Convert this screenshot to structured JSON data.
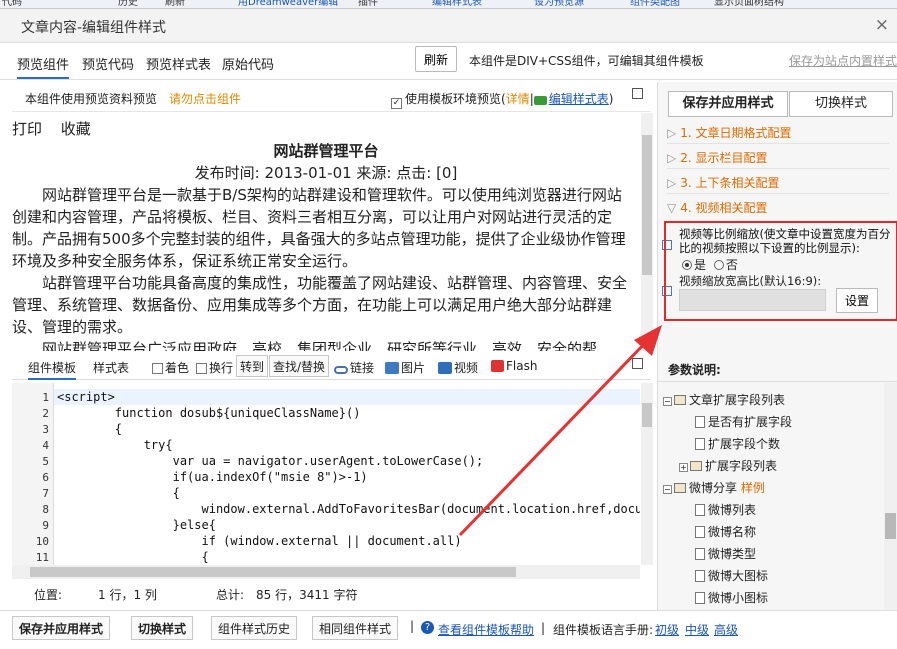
{
  "bgbar": {
    "items": [
      "代码",
      "历史",
      "刷新",
      "用Dreamweaver编辑",
      "插件",
      "编辑样式表",
      "设为预览源",
      "组件类配图",
      "显示页面树结构"
    ]
  },
  "dialog": {
    "title": "文章内容-编辑组件样式",
    "close": "×"
  },
  "tabs": [
    {
      "label": "预览组件",
      "active": true
    },
    {
      "label": "预览代码"
    },
    {
      "label": "预览样式表"
    },
    {
      "label": "原始代码"
    }
  ],
  "toolbar": {
    "refresh": "刷新",
    "note": "本组件是DIV+CSS组件，可编辑其组件模板",
    "save_site": "保存为站点内置样式"
  },
  "preview_head": {
    "label": "本组件使用预览资料预览",
    "click": "请勿点击组件",
    "checkbox": "使用模板环境预览(",
    "detail": "详情",
    "sep": "|",
    "edit_css": "编辑样式表",
    "close": ")"
  },
  "article": {
    "actions": [
      "打印",
      "收藏"
    ],
    "title": "网站群管理平台",
    "meta": "发布时间:  2013-01-01 来源:      点击: [0]",
    "paragraphs": [
      "网站群管理平台是一款基于B/S架构的站群建设和管理软件。可以使用纯浏览器进行网站创建和内容管理，产品将模板、栏目、资料三者相互分离，可以让用户对网站进行灵活的定制。产品拥有500多个完整封装的组件，具备强大的多站点管理功能，提供了企业级协作管理环境及多种安全服务体系，保证系统正常安全运行。",
      "站群管理平台功能具备高度的集成性，功能覆盖了网站建设、站群管理、内容管理、安全管理、系统管理、数据备份、应用集成等多个方面，在功能上可以满足用户绝大部分站群建设、管理的需求。",
      "网站群管理平台广泛应用政府、高校、集团型企业、研究所等行业、高效、安全的帮"
    ]
  },
  "editor_toolbar": {
    "tab_template": "组件模板",
    "tab_css": "样式表",
    "color": "着色",
    "wrap": "换行",
    "goto": "转到",
    "find": "查找/替换",
    "link": "链接",
    "image": "图片",
    "video": "视频",
    "flash": "Flash"
  },
  "code": {
    "lines": [
      "<script>",
      "        function dosub${uniqueClassName}()",
      "        {",
      "            try{",
      "                var ua = navigator.userAgent.toLowerCase();",
      "                if(ua.indexOf(\"msie 8\")>-1)",
      "                {",
      "                    window.external.AddToFavoritesBar(document.location.href,document.t",
      "                }else{",
      "                    if (window.external || document.all)",
      "                    {"
    ],
    "numbers": [
      "1",
      "2",
      "3",
      "4",
      "5",
      "6",
      "7",
      "8",
      "9",
      "10",
      "11"
    ]
  },
  "status": {
    "pos_label": "位置:",
    "pos": "1 行，1 列",
    "total_label": "总计:",
    "total": "85 行，3411 字符"
  },
  "footer": {
    "save_apply": "保存并应用样式",
    "switch": "切换样式",
    "history": "组件样式历史",
    "same": "相同组件样式",
    "help": "查看组件模板帮助",
    "lang": "组件模板语言手册:",
    "levels": [
      "初级",
      "中级",
      "高级"
    ],
    "sep": "|"
  },
  "right": {
    "save_apply": "保存并应用样式",
    "switch": "切换样式",
    "sections": [
      "1. 文章日期格式配置",
      "2. 显示栏目配置",
      "3. 上下条相关配置",
      "4. 视频相关配置"
    ],
    "cfg_scale": "视频等比例缩放(使文章中设置宽度为百分比的视频按照以下设置的比例显示):",
    "opt_yes": "是",
    "opt_no": "否",
    "cfg_ratio": "视频缩放宽高比(默认16:9):",
    "ratio_value": "",
    "set": "设置",
    "params_title": "参数说明:",
    "tree": [
      {
        "label": "文章扩展字段列表",
        "level": 0,
        "type": "folder"
      },
      {
        "label": "是否有扩展字段",
        "level": 1,
        "type": "doc"
      },
      {
        "label": "扩展字段个数",
        "level": 1,
        "type": "doc"
      },
      {
        "label": "扩展字段列表",
        "level": 1,
        "type": "folder"
      },
      {
        "label": "微博分享",
        "level": 0,
        "type": "folder",
        "extra": "样例"
      },
      {
        "label": "微博列表",
        "level": 1,
        "type": "doc"
      },
      {
        "label": "微博名称",
        "level": 1,
        "type": "doc"
      },
      {
        "label": "微博类型",
        "level": 1,
        "type": "doc"
      },
      {
        "label": "微博大图标",
        "level": 1,
        "type": "doc"
      },
      {
        "label": "微博小图标",
        "level": 1,
        "type": "doc"
      }
    ]
  },
  "colors": {
    "accent": "#2b6cc4",
    "orange": "#e06a00",
    "red": "#e02a2a",
    "link": "#1a56b5"
  }
}
